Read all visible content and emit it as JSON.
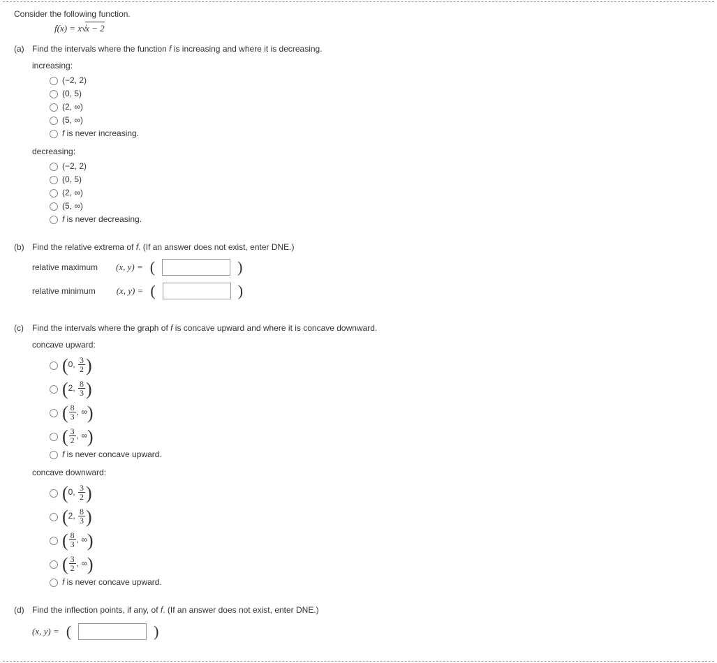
{
  "prompt": "Consider the following function.",
  "formula_lhs": "f(x) = x",
  "formula_rad": "x − 2",
  "parts": {
    "a": {
      "label": "(a)",
      "q": "Find the intervals where the function f is increasing and where it is decreasing.",
      "inc_h": "increasing:",
      "dec_h": "decreasing:",
      "opts_inc": [
        "(−2, 2)",
        "(0, 5)",
        "(2, ∞)",
        "(5, ∞)"
      ],
      "opts_inc_last": "f is never increasing.",
      "opts_dec": [
        "(−2, 2)",
        "(0, 5)",
        "(2, ∞)",
        "(5, ∞)"
      ],
      "opts_dec_last": "f is never decreasing."
    },
    "b": {
      "label": "(b)",
      "q": "Find the relative extrema of f. (If an answer does not exist, enter DNE.)",
      "max_l": "relative maximum",
      "min_l": "relative minimum",
      "xy": "(x, y) ="
    },
    "c": {
      "label": "(c)",
      "q": "Find the intervals where the graph of f is concave upward and where it is concave downward.",
      "up_h": "concave upward:",
      "dn_h": "concave downward:",
      "never_up": "f is never concave upward.",
      "never_up2": "f is never concave upward.",
      "fracs": [
        {
          "a": "0",
          "n": "3",
          "d": "2"
        },
        {
          "a": "2",
          "n": "8",
          "d": "3"
        },
        {
          "na": "8",
          "da": "3",
          "b": "∞"
        },
        {
          "na": "3",
          "da": "2",
          "b": "∞"
        }
      ]
    },
    "d": {
      "label": "(d)",
      "q": "Find the inflection points, if any, of f. (If an answer does not exist, enter DNE.)",
      "xy": "(x, y) ="
    }
  }
}
